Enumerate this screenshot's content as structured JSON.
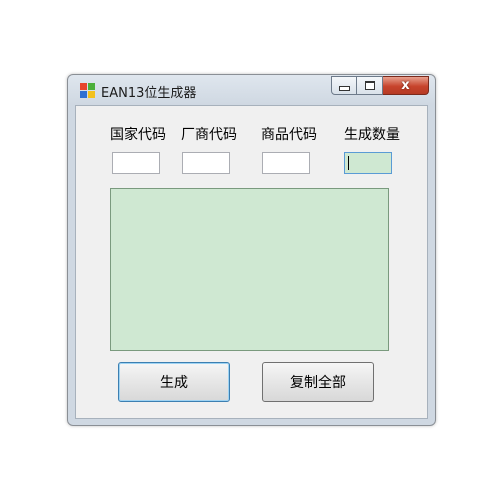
{
  "window": {
    "title": "EAN13位生成器",
    "icon": "windows-app-icon",
    "caption_buttons": [
      "minimize-icon",
      "maximize-icon",
      "close-icon"
    ],
    "close_glyph": "x"
  },
  "form": {
    "labels": {
      "country_code": "国家代码",
      "manufacturer_code": "厂商代码",
      "product_code": "商品代码",
      "quantity": "生成数量"
    },
    "values": {
      "country_code": "",
      "manufacturer_code": "",
      "product_code": "",
      "quantity": ""
    },
    "output_text": ""
  },
  "buttons": {
    "generate": "生成",
    "copy_all": "复制全部"
  },
  "colors": {
    "output_background": "#cfe8d2",
    "active_input_background": "#cfe8d2",
    "close_button": "#c7442c"
  }
}
